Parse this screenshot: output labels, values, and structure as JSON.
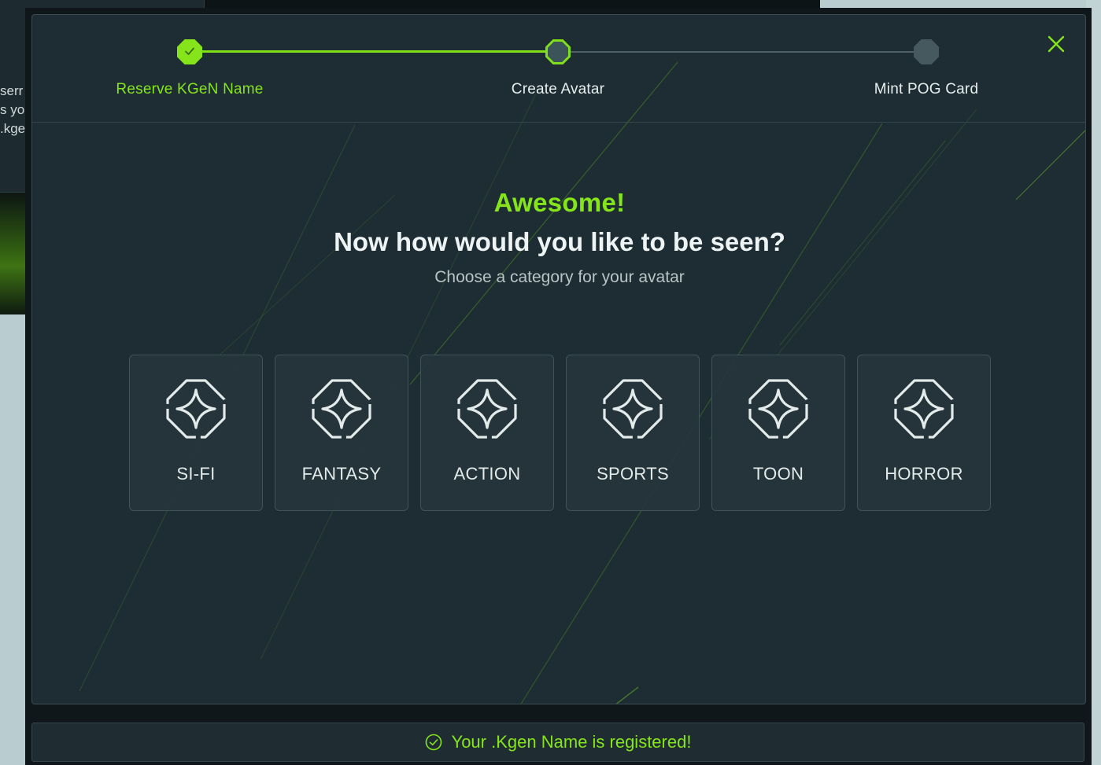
{
  "background": {
    "partial_text_lines": [
      "serr",
      "s yo",
      ".kge"
    ]
  },
  "stepper": {
    "steps": [
      {
        "label": "Reserve KGeN Name",
        "state": "completed"
      },
      {
        "label": "Create Avatar",
        "state": "current"
      },
      {
        "label": "Mint POG Card",
        "state": "upcoming"
      }
    ]
  },
  "hero": {
    "heading": "Awesome!",
    "question": "Now how would you like to be seen?",
    "subtitle": "Choose a category for your avatar"
  },
  "categories": [
    {
      "label": "SI-FI",
      "icon": "sparkle-octagon-icon"
    },
    {
      "label": "FANTASY",
      "icon": "sparkle-octagon-icon"
    },
    {
      "label": "ACTION",
      "icon": "sparkle-octagon-icon"
    },
    {
      "label": "SPORTS",
      "icon": "sparkle-octagon-icon"
    },
    {
      "label": "TOON",
      "icon": "sparkle-octagon-icon"
    },
    {
      "label": "HORROR",
      "icon": "sparkle-octagon-icon"
    }
  ],
  "toast": {
    "message": "Your .Kgen Name is registered!",
    "icon": "check-circle-icon"
  },
  "colors": {
    "accent": "#86e51a",
    "modal_bg": "#1e2d33",
    "card_border": "#3f5358"
  }
}
